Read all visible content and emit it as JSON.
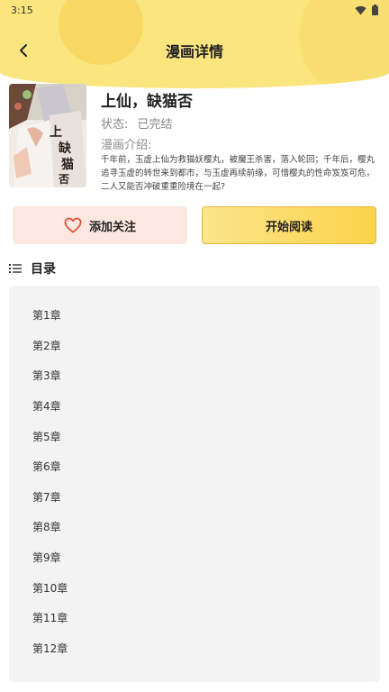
{
  "status_bar": {
    "time": "3:15"
  },
  "header": {
    "title": "漫画详情"
  },
  "book": {
    "title": "上仙，缺猫否",
    "status_label": "状态:",
    "status_value": "已完结",
    "intro_label": "漫画介绍:",
    "intro_text": "千年前，玉虚上仙为救猫妖樱丸，被魔王杀害，落入轮回；千年后，樱丸追寻玉虚的转世来到都市，与玉虚再续前缘，可惜樱丸的性命岌岌可危，二人又能否冲破重重险境在一起?"
  },
  "actions": {
    "follow_label": "添加关注",
    "read_label": "开始阅读"
  },
  "toc": {
    "title": "目录",
    "chapters": [
      "第1章",
      "第2章",
      "第3章",
      "第4章",
      "第5章",
      "第6章",
      "第7章",
      "第8章",
      "第9章",
      "第10章",
      "第11章",
      "第12章"
    ]
  },
  "colors": {
    "header_yellow": "#fae57f",
    "follow_bg": "#fde8e1",
    "read_bg": "#fbd24a",
    "heart": "#e0533a"
  }
}
